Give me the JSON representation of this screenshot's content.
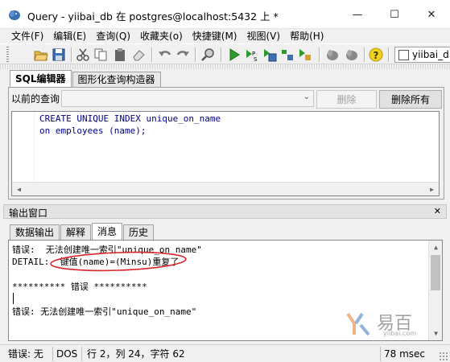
{
  "window": {
    "title": "Query - yiibai_db 在  postgres@localhost:5432 上 *",
    "minimize": "—",
    "maximize": "☐",
    "close": "✕"
  },
  "menu": [
    "文件(F)",
    "编辑(E)",
    "查询(Q)",
    "收藏夹(o)",
    "快捷键(M)",
    "视图(V)",
    "帮助(H)"
  ],
  "toolbar": {
    "db_dropdown": "yiibai_d"
  },
  "query_panel": {
    "tabs": [
      "SQL编辑器",
      "图形化查询构造器"
    ],
    "active_tab": "SQL编辑器",
    "history_label": "以前的查询",
    "history_value": "",
    "delete_button": "删除",
    "delete_all_button": "删除所有",
    "sql_lines": [
      "CREATE UNIQUE INDEX unique_on_name",
      "on employees (name);"
    ]
  },
  "output_panel": {
    "title": "输出窗口",
    "close": "✕",
    "tabs": [
      "数据输出",
      "解释",
      "消息",
      "历史"
    ],
    "active_tab": "消息",
    "messages": [
      "错误:  无法创建唯一索引\"unique_on_name\"",
      "DETAIL:  键值(name)=(Minsu)重复了",
      "",
      "********** 错误 **********",
      "",
      "错误: 无法创建唯一索引\"unique_on_name\""
    ]
  },
  "status": {
    "error": "错误: 无",
    "line_ending": "DOS",
    "position": "行 2，列 24，字符 62",
    "duration": "78 msec"
  },
  "watermark": {
    "brand": "易百",
    "url": "yiibai.com"
  },
  "colors": {
    "highlight_ellipse": "#d9242a",
    "sql_text": "#00008b"
  }
}
